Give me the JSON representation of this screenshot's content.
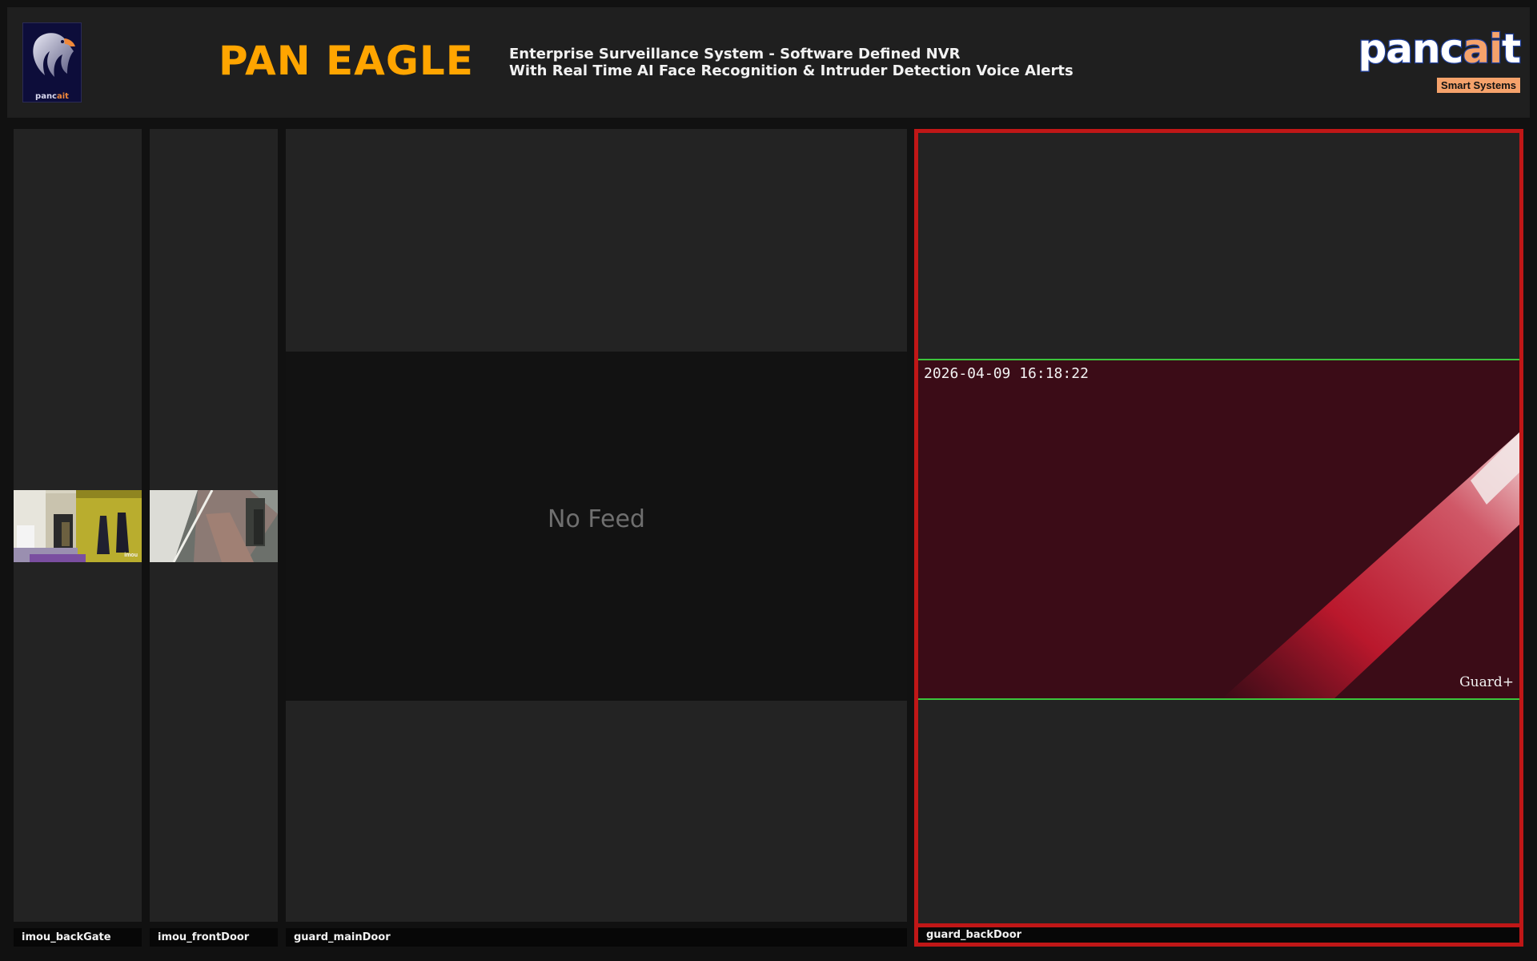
{
  "header": {
    "logo_caption_a": "panc",
    "logo_caption_b": "ait",
    "title": "PAN EAGLE",
    "subtitle_line1": "Enterprise Surveillance System - Software Defined NVR",
    "subtitle_line2": "With Real Time AI Face Recognition & Intruder Detection Voice Alerts",
    "brand_word_a": "panc",
    "brand_word_b": "ai",
    "brand_word_c": "t",
    "brand_tagline": "Smart Systems"
  },
  "cameras": [
    {
      "name": "imou_backGate",
      "status": "live",
      "watermark": "imou"
    },
    {
      "name": "imou_frontDoor",
      "status": "live"
    },
    {
      "name": "guard_mainDoor",
      "status": "No Feed"
    },
    {
      "name": "guard_backDoor",
      "status": "live",
      "timestamp": "2026-04-09 16:18:22",
      "watermark": "Guard+",
      "alert": true
    }
  ],
  "colors": {
    "title": "#ffa500",
    "alert_border": "#c01717",
    "feed_bounds": "#3cc43c",
    "brand_accent": "#f5a26b",
    "brand_outline": "#1f3f9c"
  }
}
